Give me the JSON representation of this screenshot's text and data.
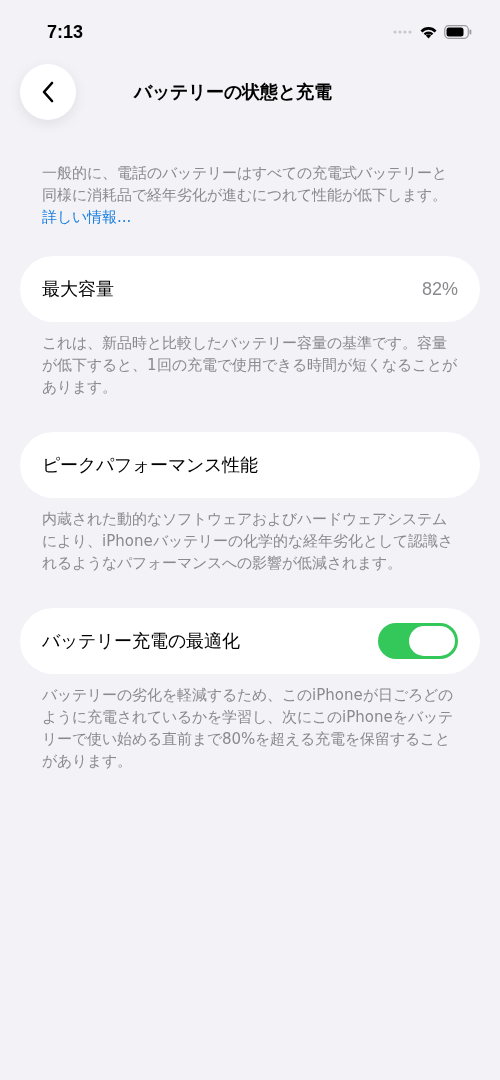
{
  "status_bar": {
    "time": "7:13"
  },
  "nav": {
    "title": "バッテリーの状態と充電"
  },
  "intro": {
    "text": "一般的に、電話のバッテリーはすべての充電式バッテリーと同様に消耗品で経年劣化が進むにつれて性能が低下します。",
    "link": "詳しい情報..."
  },
  "sections": [
    {
      "kind": "value",
      "label": "最大容量",
      "value": "82%",
      "footer": "これは、新品時と比較したバッテリー容量の基準です。容量が低下すると、1回の充電で使用できる時間が短くなることがあります。"
    },
    {
      "kind": "plain",
      "label": "ピークパフォーマンス性能",
      "footer": "内蔵された動的なソフトウェアおよびハードウェアシステムにより、iPhoneバッテリーの化学的な経年劣化として認識されるようなパフォーマンスへの影響が低減されます。"
    },
    {
      "kind": "toggle",
      "label": "バッテリー充電の最適化",
      "on": true,
      "footer": "バッテリーの劣化を軽減するため、このiPhoneが日ごろどのように充電されているかを学習し、次にこのiPhoneをバッテリーで使い始める直前まで80%を超える充電を保留することがあります。"
    }
  ]
}
